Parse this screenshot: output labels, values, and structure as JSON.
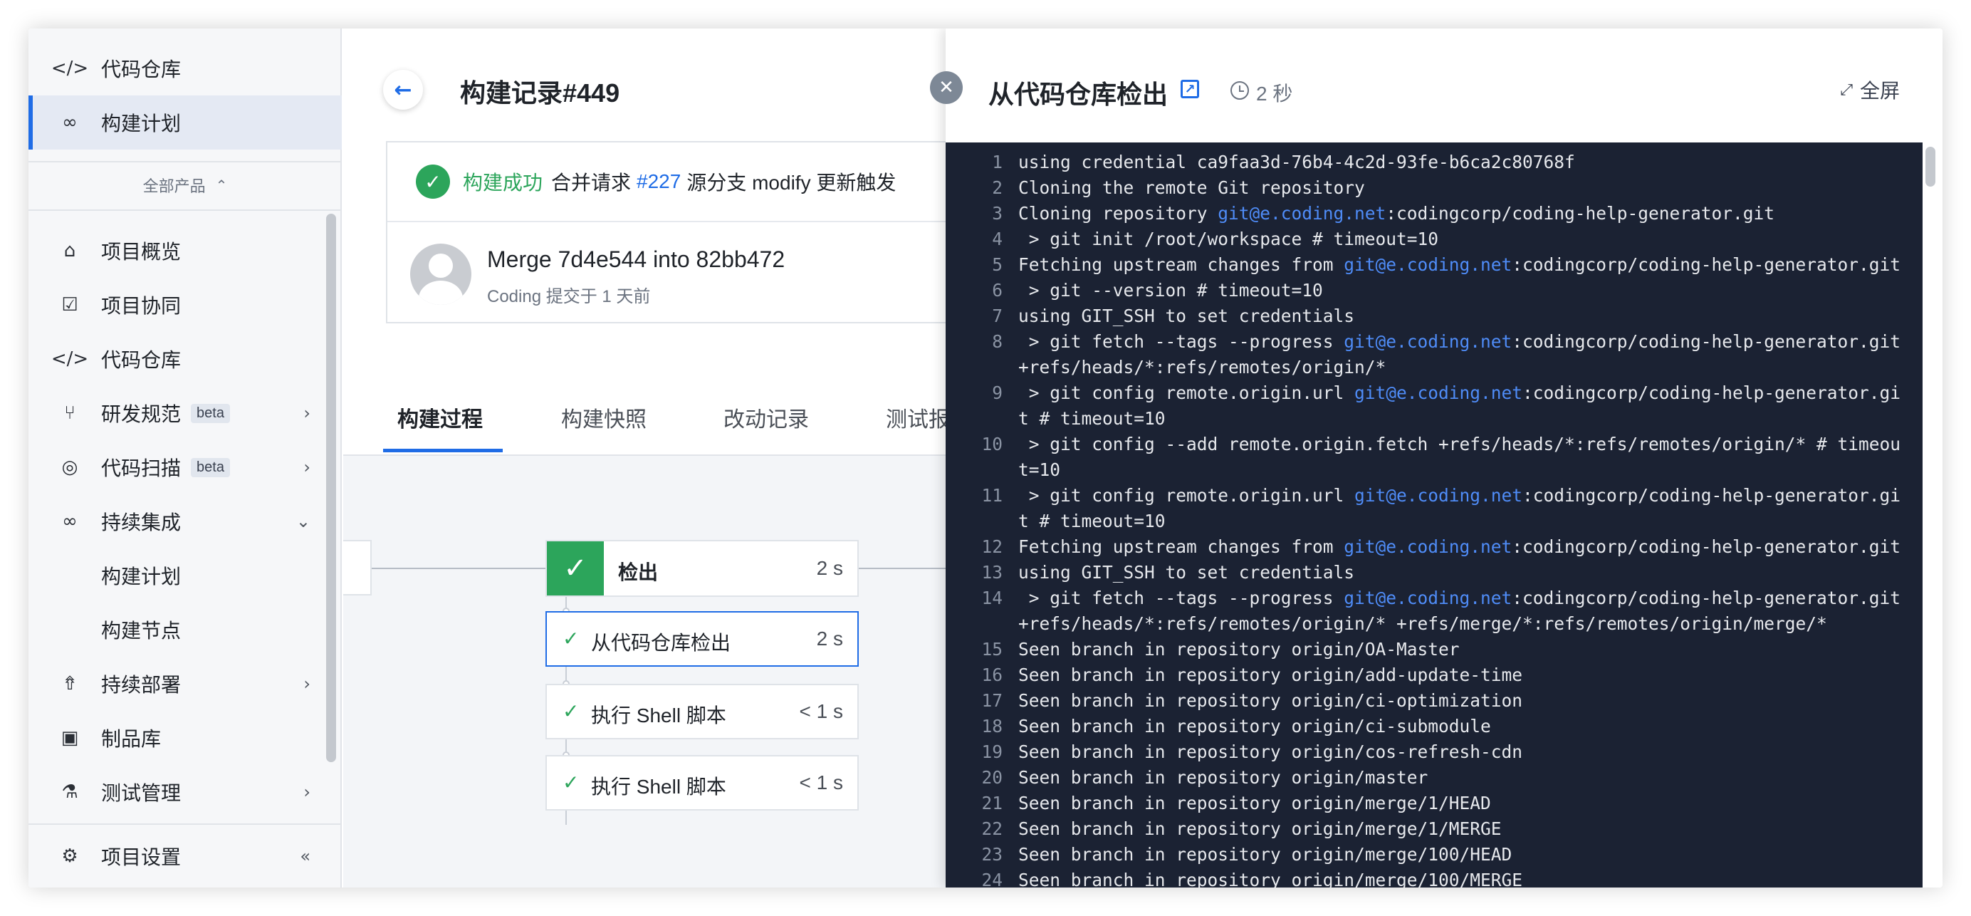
{
  "sidebar": {
    "top_items": [
      {
        "label": "代码仓库",
        "icon": "code-icon"
      },
      {
        "label": "构建计划",
        "icon": "infinity-icon"
      }
    ],
    "all_products": "全部产品",
    "items": [
      {
        "label": "项目概览",
        "icon": "home-icon"
      },
      {
        "label": "项目协同",
        "icon": "checkbox-icon"
      },
      {
        "label": "代码仓库",
        "icon": "code-icon"
      },
      {
        "label": "研发规范",
        "icon": "branch-rule-icon",
        "badge": "beta"
      },
      {
        "label": "代码扫描",
        "icon": "scan-icon",
        "badge": "beta"
      },
      {
        "label": "持续集成",
        "icon": "infinity-icon"
      },
      {
        "label": "构建计划"
      },
      {
        "label": "构建节点"
      },
      {
        "label": "持续部署",
        "icon": "rocket-icon"
      },
      {
        "label": "制品库",
        "icon": "package-icon"
      },
      {
        "label": "测试管理",
        "icon": "flask-icon"
      }
    ],
    "settings": "项目设置"
  },
  "main": {
    "title": "构建记录#449",
    "status": {
      "label": "构建成功",
      "text1": "合并请求",
      "mr": "#227",
      "text2": "源分支 modify 更新触发"
    },
    "commit": {
      "message": "Merge 7d4e544 into 82bb472",
      "meta": "Coding 提交于 1 天前"
    },
    "tabs": [
      "构建过程",
      "构建快照",
      "改动记录",
      "测试报告"
    ],
    "stage": {
      "name": "检出",
      "time": "2 s"
    },
    "steps": [
      {
        "name": "从代码仓库检出",
        "time": "2 s"
      },
      {
        "name": "执行 Shell 脚本",
        "time": "< 1 s"
      },
      {
        "name": "执行 Shell 脚本",
        "time": "< 1 s"
      }
    ]
  },
  "panel": {
    "title": "从代码仓库检出",
    "duration": "2 秒",
    "fullscreen": "全屏",
    "log": [
      {
        "n": "1",
        "parts": [
          "using credential ca9faa3d-76b4-4c2d-93fe-b6ca2c80768f"
        ]
      },
      {
        "n": "2",
        "parts": [
          "Cloning the remote Git repository"
        ]
      },
      {
        "n": "3",
        "parts": [
          "Cloning repository ",
          {
            "url": "git@e.coding.net"
          },
          ":codingcorp/coding-help-generator.git"
        ]
      },
      {
        "n": "4",
        "parts": [
          " > git init /root/workspace # timeout=10"
        ]
      },
      {
        "n": "5",
        "parts": [
          "Fetching upstream changes from ",
          {
            "url": "git@e.coding.net"
          },
          ":codingcorp/coding-help-generator.git"
        ]
      },
      {
        "n": "6",
        "parts": [
          " > git --version # timeout=10"
        ]
      },
      {
        "n": "7",
        "parts": [
          "using GIT_SSH to set credentials"
        ]
      },
      {
        "n": "8",
        "parts": [
          " > git fetch --tags --progress ",
          {
            "url": "git@e.coding.net"
          },
          ":codingcorp/coding-help-generator.git +refs/heads/*:refs/remotes/origin/*"
        ]
      },
      {
        "n": "9",
        "parts": [
          " > git config remote.origin.url ",
          {
            "url": "git@e.coding.net"
          },
          ":codingcorp/coding-help-generator.git # timeout=10"
        ]
      },
      {
        "n": "10",
        "parts": [
          " > git config --add remote.origin.fetch +refs/heads/*:refs/remotes/origin/* # timeout=10"
        ]
      },
      {
        "n": "11",
        "parts": [
          " > git config remote.origin.url ",
          {
            "url": "git@e.coding.net"
          },
          ":codingcorp/coding-help-generator.git # timeout=10"
        ]
      },
      {
        "n": "12",
        "parts": [
          "Fetching upstream changes from ",
          {
            "url": "git@e.coding.net"
          },
          ":codingcorp/coding-help-generator.git"
        ]
      },
      {
        "n": "13",
        "parts": [
          "using GIT_SSH to set credentials"
        ]
      },
      {
        "n": "14",
        "parts": [
          " > git fetch --tags --progress ",
          {
            "url": "git@e.coding.net"
          },
          ":codingcorp/coding-help-generator.git +refs/heads/*:refs/remotes/origin/* +refs/merge/*:refs/remotes/origin/merge/*"
        ]
      },
      {
        "n": "15",
        "parts": [
          "Seen branch in repository origin/OA-Master"
        ]
      },
      {
        "n": "16",
        "parts": [
          "Seen branch in repository origin/add-update-time"
        ]
      },
      {
        "n": "17",
        "parts": [
          "Seen branch in repository origin/ci-optimization"
        ]
      },
      {
        "n": "18",
        "parts": [
          "Seen branch in repository origin/ci-submodule"
        ]
      },
      {
        "n": "19",
        "parts": [
          "Seen branch in repository origin/cos-refresh-cdn"
        ]
      },
      {
        "n": "20",
        "parts": [
          "Seen branch in repository origin/master"
        ]
      },
      {
        "n": "21",
        "parts": [
          "Seen branch in repository origin/merge/1/HEAD"
        ]
      },
      {
        "n": "22",
        "parts": [
          "Seen branch in repository origin/merge/1/MERGE"
        ]
      },
      {
        "n": "23",
        "parts": [
          "Seen branch in repository origin/merge/100/HEAD"
        ]
      },
      {
        "n": "24",
        "parts": [
          "Seen branch in repository origin/merge/100/MERGE"
        ]
      }
    ]
  }
}
